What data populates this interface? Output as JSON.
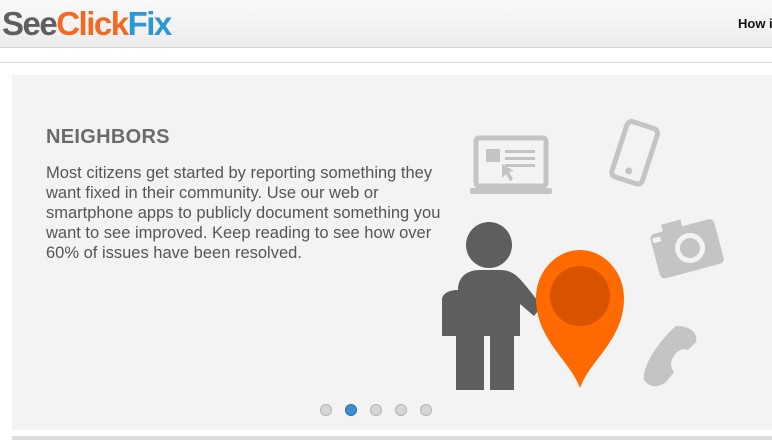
{
  "header": {
    "logo": {
      "see": "See",
      "click": "Click",
      "fix": "Fix"
    },
    "nav_link": "How i"
  },
  "slide": {
    "title": "NEIGHBORS",
    "body": "Most citizens get started by reporting something they want fixed in their community. Use our web or smartphone apps to publicly document something you want to see improved. Keep reading to see how over 60% of issues have been resolved."
  },
  "carousel": {
    "slide_count": 5,
    "active_index": 1
  },
  "colors": {
    "logo_see": "#5f5f5f",
    "logo_click": "#f26a22",
    "logo_fix": "#2c97d3",
    "pin_orange": "#ff6a00",
    "person_gray": "#5e5e5e",
    "icon_gray": "#c4c4c4",
    "active_dot": "#3d8ed0"
  }
}
